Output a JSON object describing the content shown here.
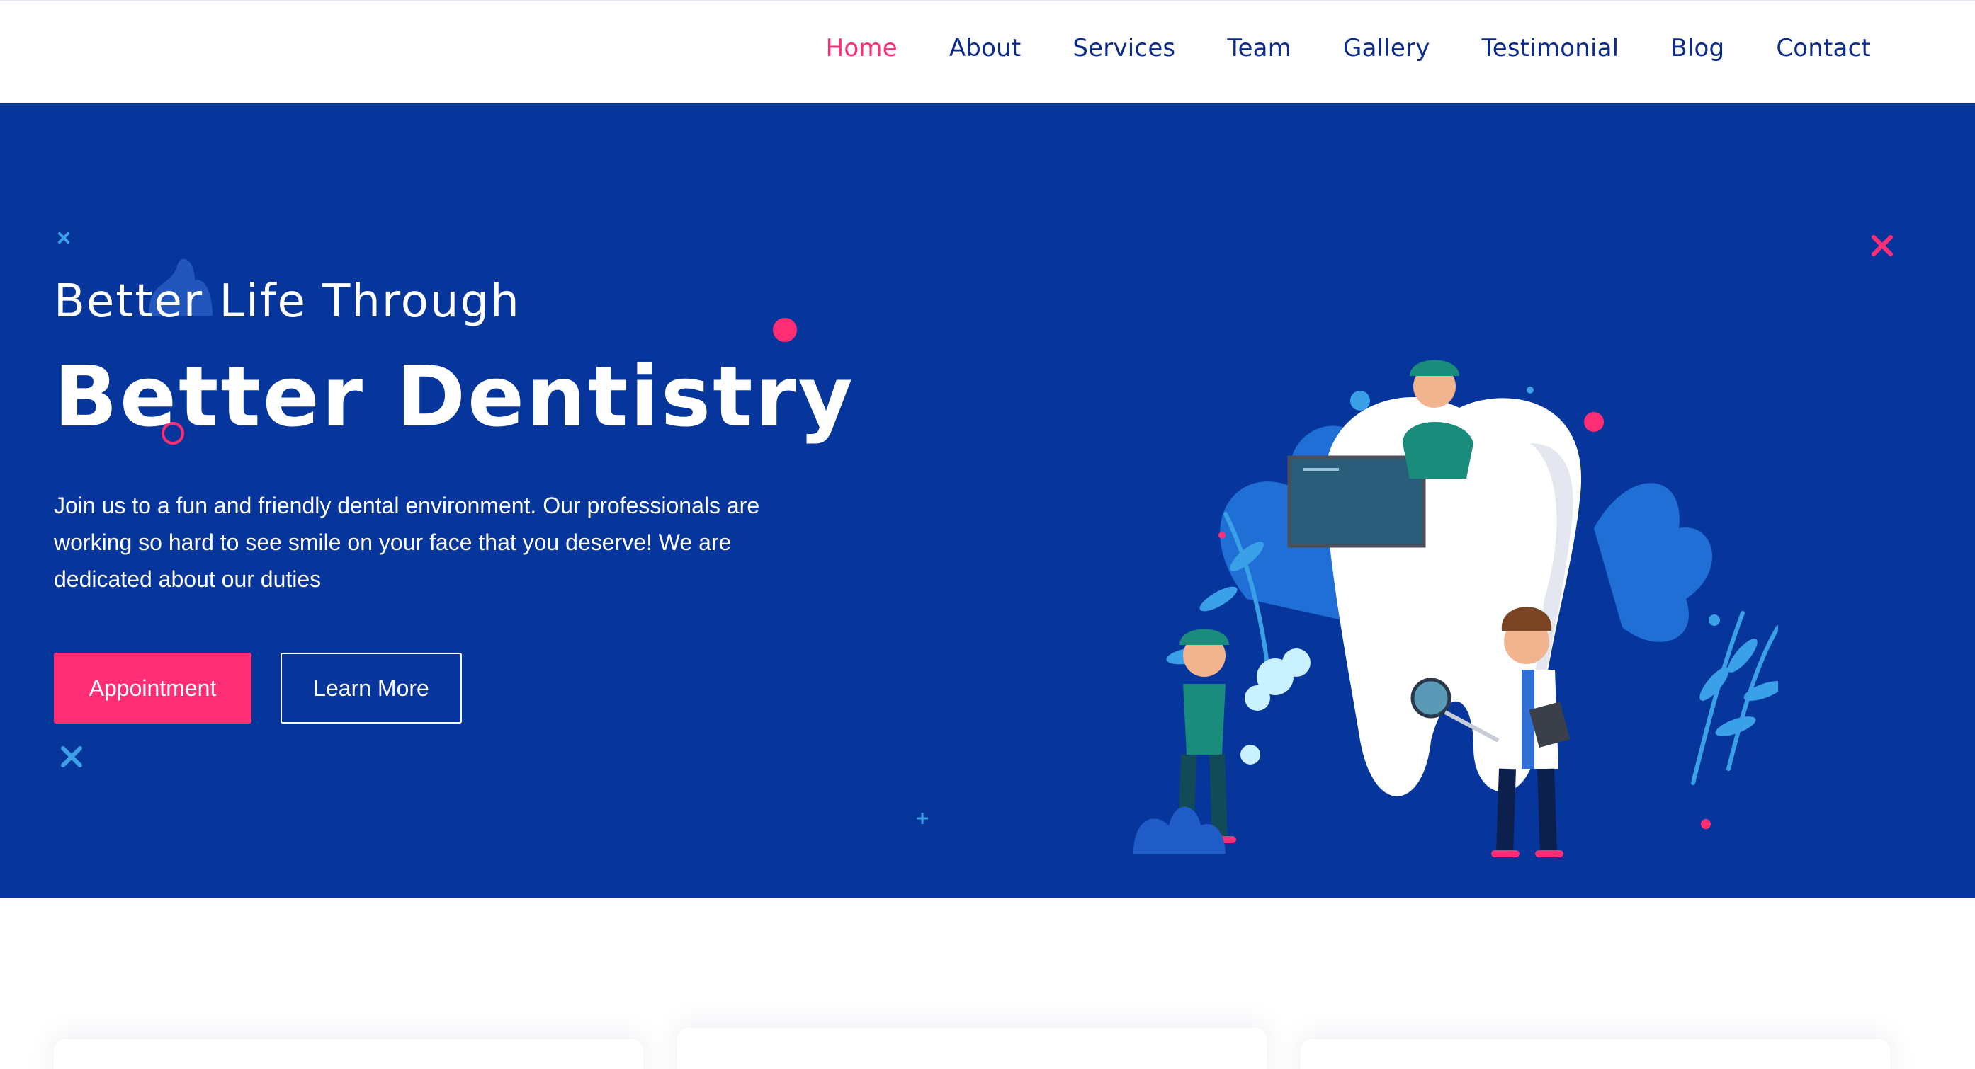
{
  "nav": {
    "items": [
      {
        "label": "Home",
        "active": true
      },
      {
        "label": "About",
        "active": false
      },
      {
        "label": "Services",
        "active": false
      },
      {
        "label": "Team",
        "active": false
      },
      {
        "label": "Gallery",
        "active": false
      },
      {
        "label": "Testimonial",
        "active": false
      },
      {
        "label": "Blog",
        "active": false
      },
      {
        "label": "Contact",
        "active": false
      }
    ]
  },
  "hero": {
    "subtitle": "Better Life Through",
    "title": "Better Dentistry",
    "text": "Join us to a fun and friendly dental environment. Our professionals are working so hard to see smile on your face that you deserve! We are dedicated about our duties",
    "primary_button": "Appointment",
    "secondary_button": "Learn More",
    "illustration_icon": "dentist-tooth-illustration"
  },
  "colors": {
    "hero_bg": "#06359b",
    "accent": "#ff2e74",
    "nav_text": "#0b2a8c"
  }
}
